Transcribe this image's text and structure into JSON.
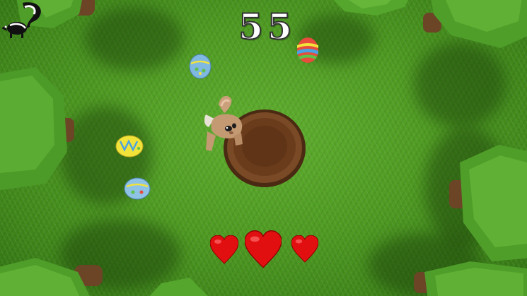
{
  "game": {
    "score": "55",
    "lives": 3
  },
  "hud": {
    "logo_icon": "skunk-logo-icon",
    "heart_color": "#e10f0f"
  },
  "scene": {
    "grass_color": "#4e9a22",
    "hole_color": "#6b3c1c",
    "egg_colors": [
      "#7fb8e0",
      "#f2e33a",
      "#7fb8e0",
      "#e74c3c"
    ]
  }
}
